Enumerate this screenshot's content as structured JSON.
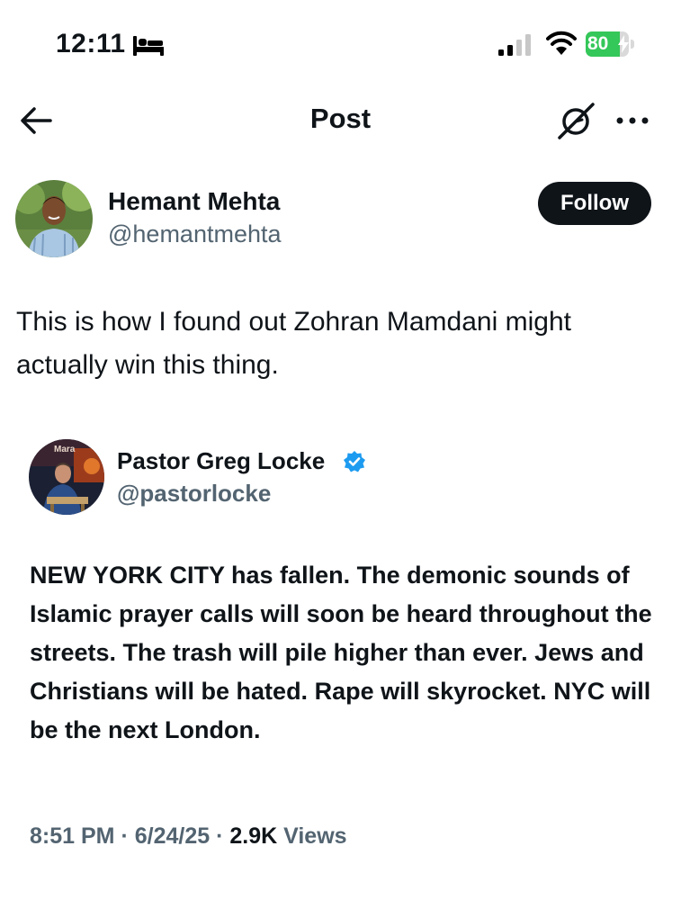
{
  "status_bar": {
    "time": "12:11",
    "battery_percent": "80",
    "battery_level": 0.8,
    "icons": [
      "bed-icon",
      "cellular-signal-icon",
      "wifi-icon",
      "battery-charging-icon"
    ]
  },
  "nav": {
    "title": "Post",
    "icons": [
      "back-arrow-icon",
      "grok-icon",
      "more-icon"
    ]
  },
  "author": {
    "name": "Hemant Mehta",
    "handle": "@hemantmehta",
    "follow_label": "Follow"
  },
  "post": {
    "text": "This is how I found out Zohran Mamdani might actually win this thing."
  },
  "quoted": {
    "name": "Pastor Greg Locke",
    "handle": "@pastorlocke",
    "verified": true,
    "avatar_sign_text": "Mara",
    "text": "NEW YORK CITY has fallen. The demonic sounds of Islamic prayer calls will soon be heard throughout the streets. The trash will pile higher than ever. Jews and Christians will be hated. Rape will skyrocket. NYC will be the next London.",
    "time": "8:51 PM",
    "date": "6/24/25",
    "views_count": "2.9K",
    "views_label": "Views"
  },
  "colors": {
    "text": "#0f1419",
    "secondary": "#536471",
    "verified_blue": "#1d9bf0",
    "battery_green": "#34c759"
  }
}
